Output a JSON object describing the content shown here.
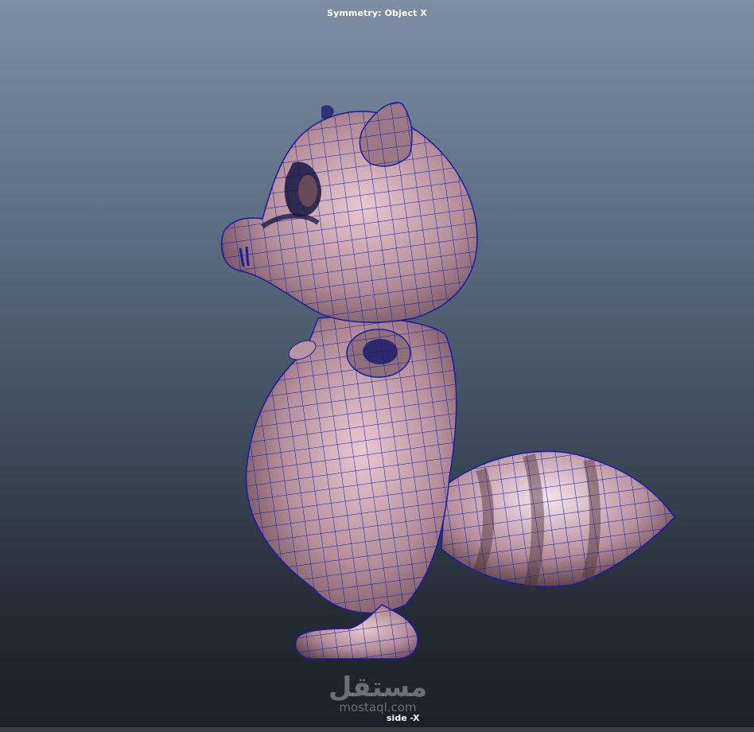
{
  "viewport": {
    "symmetry_label": "Symmetry: Object X",
    "camera_label": "side -X",
    "model_icon": "raccoon-wireframe-model",
    "colors": {
      "mesh_fill": "#b9959f",
      "wireframe": "#1a1aa8",
      "bg_top": "#7d8ea3",
      "bg_bottom": "#1a2028"
    }
  },
  "watermark": {
    "arabic": "مستقل",
    "latin": "mostaql.com"
  }
}
